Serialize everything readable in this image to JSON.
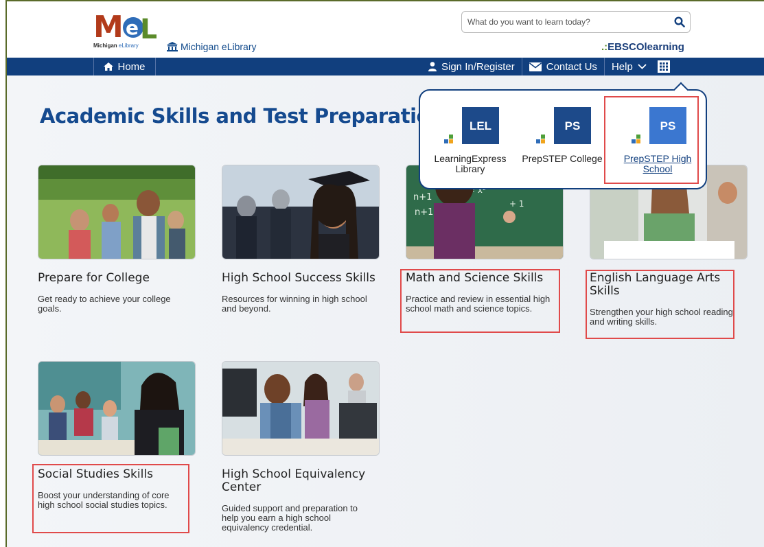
{
  "header": {
    "logo_text": "MeL",
    "logo_tag_bold": "Michigan",
    "logo_tag_rest": " eLibrary",
    "library_link": "Michigan eLibrary",
    "search_placeholder": "What do you want to learn today?",
    "brand_dots": ".:",
    "brand_ebsco": "EBSCO",
    "brand_learning": "learning"
  },
  "nav": {
    "home": "Home",
    "sign_in": "Sign In/Register",
    "contact": "Contact Us",
    "help": "Help"
  },
  "page_title": "Academic Skills and Test Preparation",
  "apps_menu": [
    {
      "abbr": "LEL",
      "label": "LearningExpress Library",
      "color": "#1d4a8a"
    },
    {
      "abbr": "PS",
      "label": "PrepSTEP College",
      "color": "#1d4a8a"
    },
    {
      "abbr": "PS",
      "label": "PrepSTEP High School",
      "color": "#3b77d0"
    }
  ],
  "cards": [
    {
      "title": "Prepare for College",
      "desc": "Get ready to achieve your college goals."
    },
    {
      "title": "High School Success Skills",
      "desc": "Resources for winning in high school and beyond."
    },
    {
      "title": "Math and Science Skills",
      "desc": "Practice and review in essential high school math and science topics."
    },
    {
      "title": "English Language Arts Skills",
      "desc": "Strengthen your high school reading and writing skills."
    },
    {
      "title": "Social Studies Skills",
      "desc": "Boost your understanding of core high school social studies topics."
    },
    {
      "title": "High School Equivalency Center",
      "desc": "Guided support and preparation to help you earn a high school equivalency credential."
    }
  ],
  "colors": {
    "nav_bg": "#113f7e",
    "title_blue": "#154a8f",
    "highlight_red": "#e04a4a",
    "ebsco_blue": "#1a3e7a"
  }
}
